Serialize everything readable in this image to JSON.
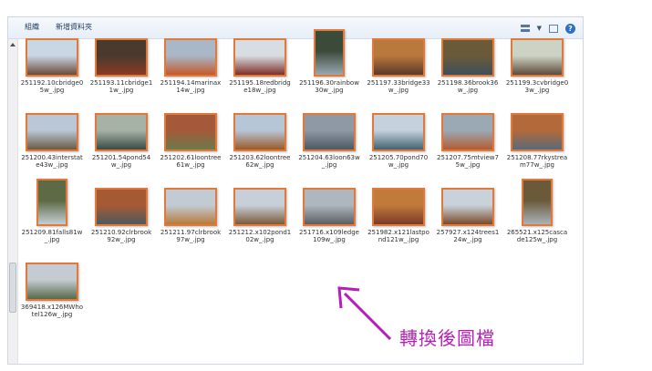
{
  "toolbar": {
    "organize_label": "組織",
    "new_folder_label": "新增資料夾",
    "views_icon": "views-icon",
    "pane_icon": "preview-pane-icon",
    "help_icon": "help-icon",
    "help_glyph": "?"
  },
  "files": [
    {
      "name": "251192.10cbridge05w_.jpg",
      "orient": "land",
      "sky": "#c9d6e4",
      "ground": "#6b4a3a"
    },
    {
      "name": "251193.11cbridge11w_.jpg",
      "orient": "land",
      "sky": "#4a3a2e",
      "ground": "#8a3a22"
    },
    {
      "name": "251194.14marinax14w_.jpg",
      "orient": "land",
      "sky": "#a9b7c7",
      "ground": "#c25a2a"
    },
    {
      "name": "251195.18redbridge18w_.jpg",
      "orient": "land",
      "sky": "#d7dde3",
      "ground": "#7e2f25"
    },
    {
      "name": "251196.30rainbow30w_.jpg",
      "orient": "port",
      "sky": "#3c4a3a",
      "ground": "#9aa7b0"
    },
    {
      "name": "251197.33bridge33w_.jpg",
      "orient": "land",
      "sky": "#b9783c",
      "ground": "#5a3a2a"
    },
    {
      "name": "251198.36brook36w_.jpg",
      "orient": "land",
      "sky": "#6a5a3a",
      "ground": "#3e4f5a"
    },
    {
      "name": "251199.3cvbridge03w_.jpg",
      "orient": "land",
      "sky": "#cdd3c4",
      "ground": "#5d4b3c"
    },
    {
      "name": "251200.43interstate43w_.jpg",
      "orient": "land",
      "sky": "#b9c7d6",
      "ground": "#6a5b42"
    },
    {
      "name": "251201.54pond54w_.jpg",
      "orient": "land",
      "sky": "#a7b2a6",
      "ground": "#3a4b45"
    },
    {
      "name": "251202.61loontree61w_.jpg",
      "orient": "land",
      "sky": "#a45a3a",
      "ground": "#6b7a4a"
    },
    {
      "name": "251203.62loontree62w_.jpg",
      "orient": "land",
      "sky": "#b7c6d6",
      "ground": "#9a5a2a"
    },
    {
      "name": "251204.63loon63w_.jpg",
      "orient": "land",
      "sky": "#8e99a5",
      "ground": "#4d5863"
    },
    {
      "name": "251205.70pond70w_.jpg",
      "orient": "land",
      "sky": "#c5d1dd",
      "ground": "#436270"
    },
    {
      "name": "251207.75mtview75w_.jpg",
      "orient": "land",
      "sky": "#9aa9b4",
      "ground": "#b35b32"
    },
    {
      "name": "251208.77rkystream77w_.jpg",
      "orient": "land",
      "sky": "#b26a3a",
      "ground": "#5a6a7a"
    },
    {
      "name": "251209.81falls81w_.jpg",
      "orient": "port",
      "sky": "#5d6a45",
      "ground": "#c6cdd2"
    },
    {
      "name": "251210.92clrbrook92w_.jpg",
      "orient": "land",
      "sky": "#a65a34",
      "ground": "#4c5a5e"
    },
    {
      "name": "251211.97clrbrook97w_.jpg",
      "orient": "land",
      "sky": "#c2cbd4",
      "ground": "#b77a3a"
    },
    {
      "name": "251212.x102pond102w_.jpg",
      "orient": "land",
      "sky": "#c7d0d9",
      "ground": "#7a5a3a"
    },
    {
      "name": "251716.x109ledge109w_.jpg",
      "orient": "land",
      "sky": "#aeb6be",
      "ground": "#5b5f63"
    },
    {
      "name": "251982.x121lastpond121w_.jpg",
      "orient": "land",
      "sky": "#c27a3a",
      "ground": "#7a3a2a"
    },
    {
      "name": "257927.x124trees124w_.jpg",
      "orient": "land",
      "sky": "#c9d2da",
      "ground": "#7a4a2a"
    },
    {
      "name": "265521.x125cascade125w_.jpg",
      "orient": "port",
      "sky": "#6a5a3a",
      "ground": "#aab3b8"
    },
    {
      "name": "369418.x126MWhotel126w_.jpg",
      "orient": "land",
      "sky": "#c4cbd2",
      "ground": "#596a48"
    }
  ],
  "annotation": {
    "text": "轉換後圖檔",
    "color": "#b61fb6"
  }
}
